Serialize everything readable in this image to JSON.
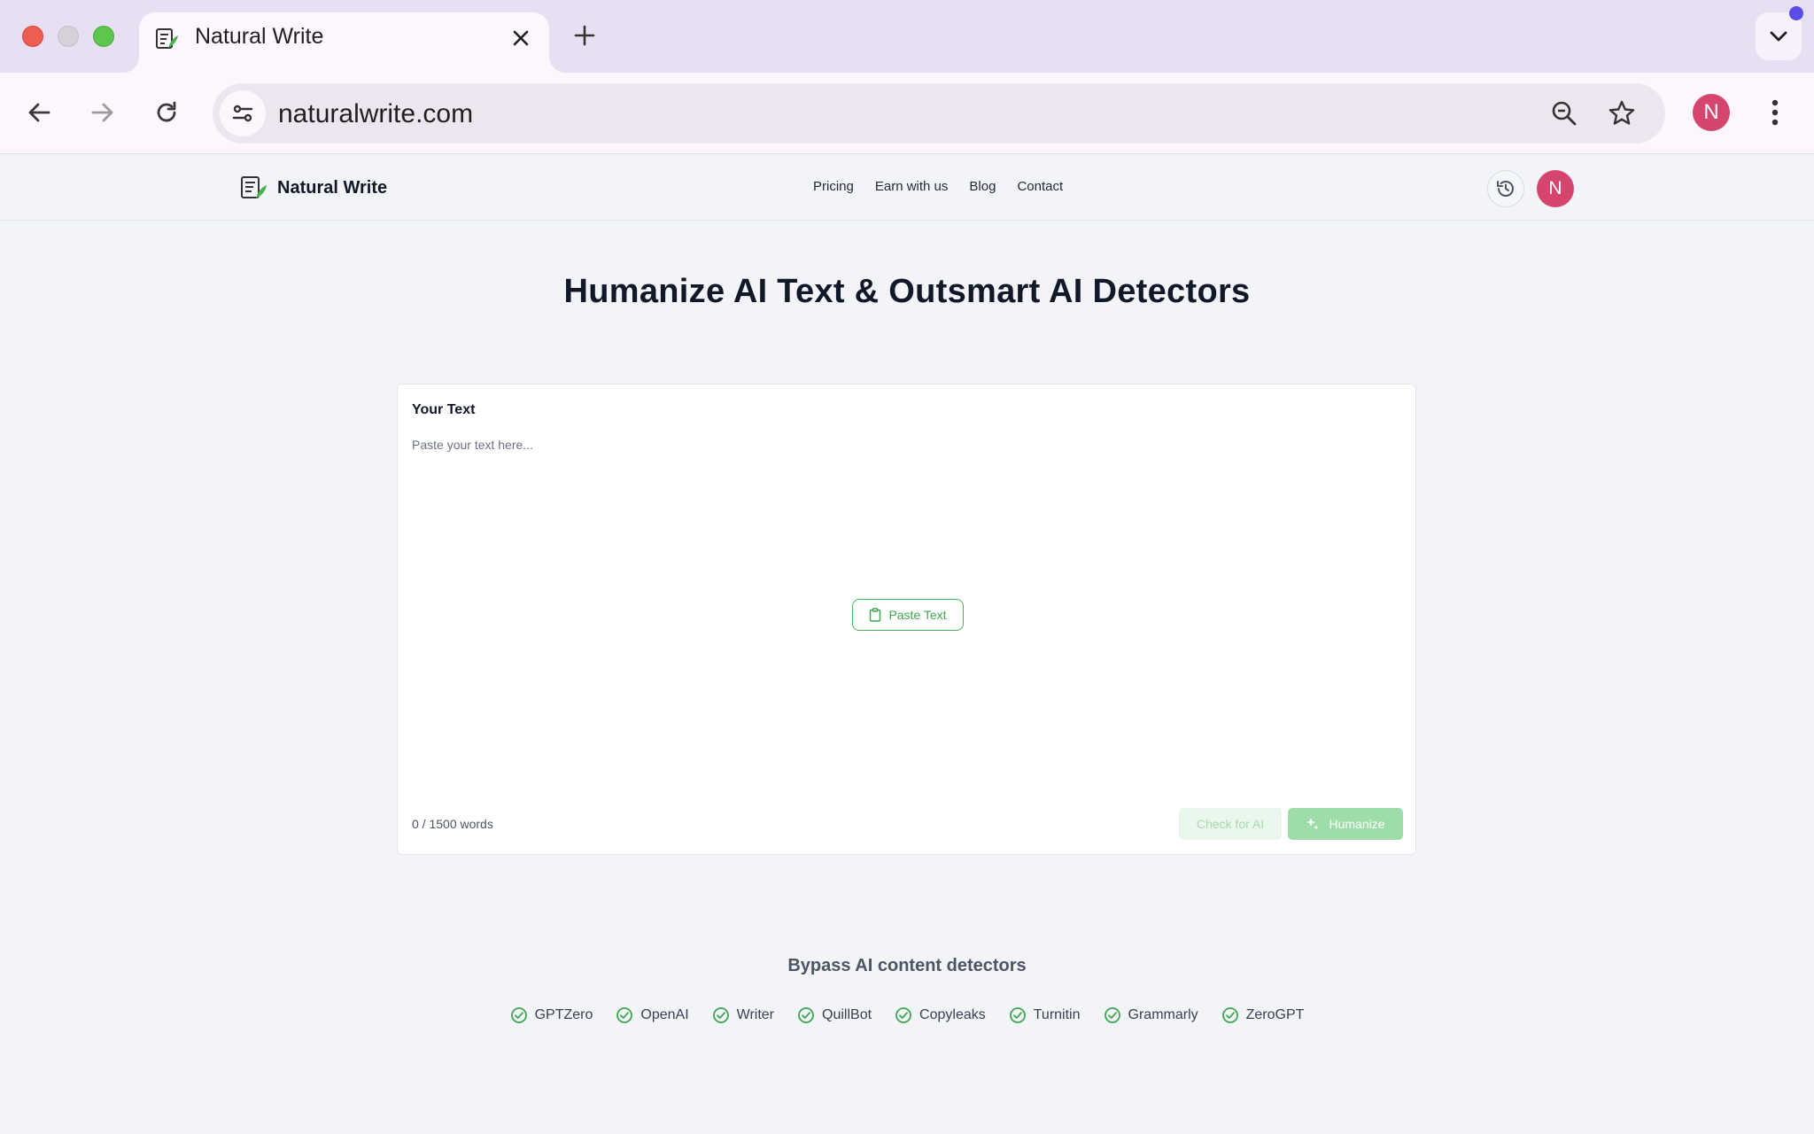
{
  "browser": {
    "tab_title": "Natural Write",
    "url": "naturalwrite.com",
    "profile_initial": "N"
  },
  "site": {
    "brand": "Natural Write",
    "nav": [
      "Pricing",
      "Earn with us",
      "Blog",
      "Contact"
    ],
    "avatar_initial": "N"
  },
  "hero": {
    "title": "Humanize AI Text & Outsmart AI Detectors"
  },
  "editor": {
    "label": "Your Text",
    "placeholder": "Paste your text here...",
    "paste_label": "Paste Text",
    "word_count": "0 / 1500 words",
    "check_label": "Check for AI",
    "humanize_label": "Humanize"
  },
  "bypass": {
    "title": "Bypass AI content detectors",
    "detectors": [
      "GPTZero",
      "OpenAI",
      "Writer",
      "QuillBot",
      "Copyleaks",
      "Turnitin",
      "Grammarly",
      "ZeroGPT"
    ]
  },
  "colors": {
    "accent_green": "#3ea653",
    "avatar_pink": "#d6456e",
    "tab_strip": "#e8dff3"
  }
}
